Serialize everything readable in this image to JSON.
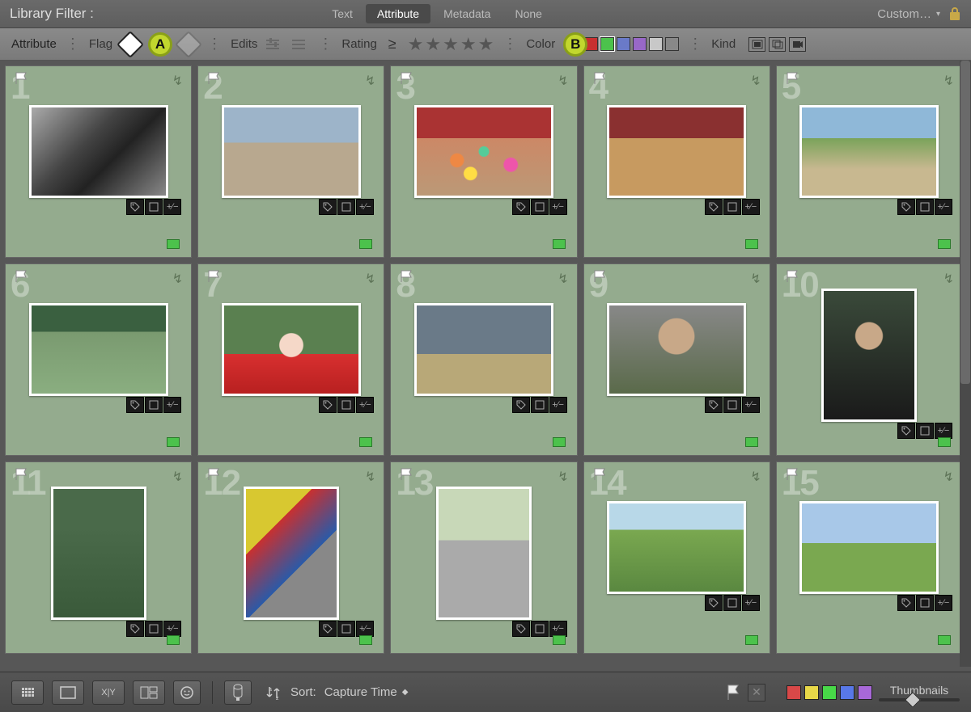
{
  "header": {
    "title": "Library Filter :",
    "tabs": [
      "Text",
      "Attribute",
      "Metadata",
      "None"
    ],
    "active_tab": 1,
    "preset": "Custom…"
  },
  "attr_bar": {
    "attribute": "Attribute",
    "flag": "Flag",
    "edits": "Edits",
    "rating": "Rating",
    "rating_op": "≥",
    "color": "Color",
    "kind": "Kind",
    "callout_a": "A",
    "callout_b": "B",
    "color_swatches": [
      "#c83030",
      "#4cc24c",
      "#6a7ac8",
      "#9868c8",
      "#c8c8c8",
      "#888888"
    ]
  },
  "grid": {
    "cells": [
      {
        "n": "1",
        "cls": "bw",
        "orient": "landscape"
      },
      {
        "n": "2",
        "cls": "street",
        "orient": "landscape"
      },
      {
        "n": "3",
        "cls": "market",
        "orient": "landscape"
      },
      {
        "n": "4",
        "cls": "stall",
        "orient": "landscape"
      },
      {
        "n": "5",
        "cls": "fruit",
        "orient": "landscape"
      },
      {
        "n": "6",
        "cls": "bench",
        "orient": "landscape"
      },
      {
        "n": "7",
        "cls": "kid",
        "orient": "landscape"
      },
      {
        "n": "8",
        "cls": "rainbow",
        "orient": "landscape"
      },
      {
        "n": "9",
        "cls": "woman",
        "orient": "landscape"
      },
      {
        "n": "10",
        "cls": "man",
        "orient": "portrait"
      },
      {
        "n": "11",
        "cls": "sit",
        "orient": "portrait"
      },
      {
        "n": "12",
        "cls": "tent",
        "orient": "portrait"
      },
      {
        "n": "13",
        "cls": "child",
        "orient": "portrait"
      },
      {
        "n": "14",
        "cls": "field",
        "orient": "landscape"
      },
      {
        "n": "15",
        "cls": "church",
        "orient": "landscape"
      }
    ]
  },
  "bottom": {
    "sort_label": "Sort:",
    "sort_value": "Capture Time",
    "thumbnails": "Thumbnails",
    "swatches": [
      "#d84848",
      "#e8d848",
      "#48d848",
      "#5878e8",
      "#a868d8"
    ]
  }
}
